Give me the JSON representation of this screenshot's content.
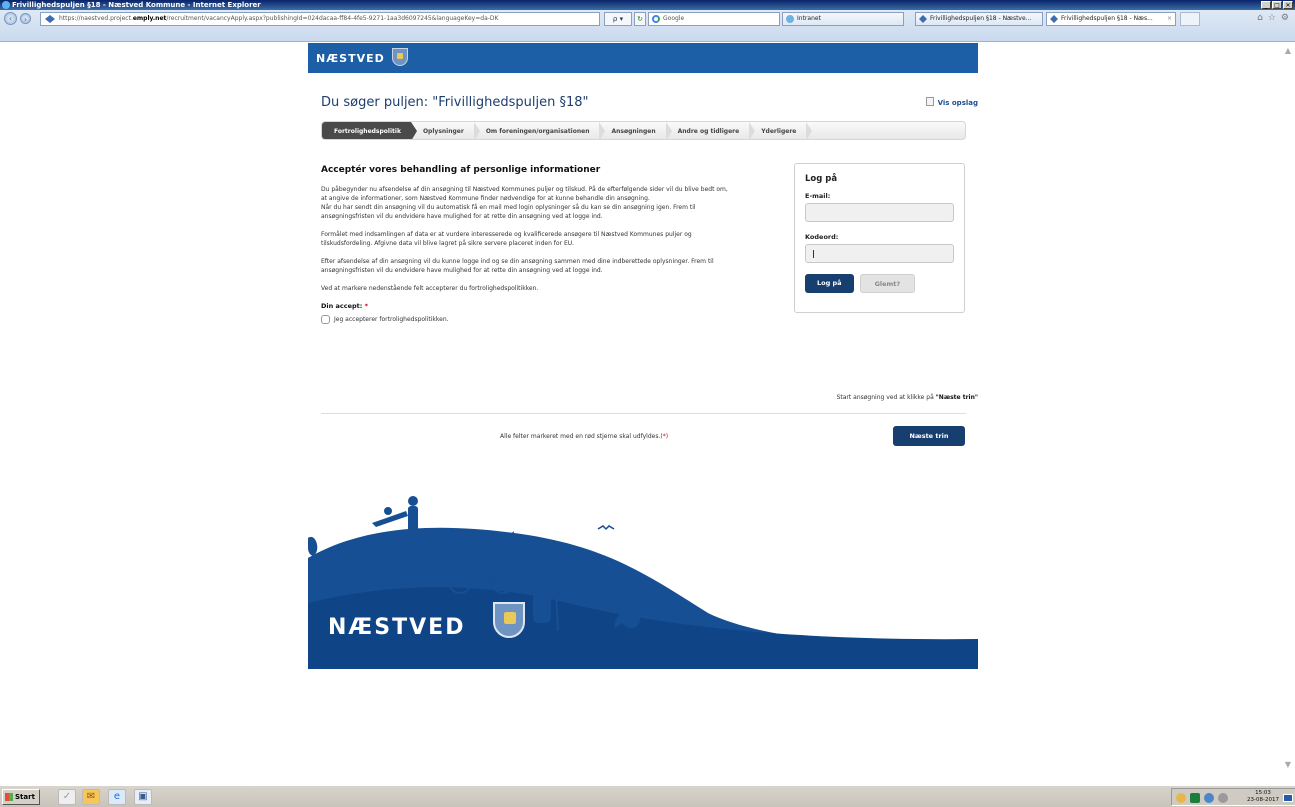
{
  "window": {
    "title": "Frivillighedspuljen §18 - Næstved Kommune - Internet Explorer",
    "controls": [
      "_",
      "□",
      "✕"
    ]
  },
  "browser": {
    "address": {
      "prefix": "https://naestved.project.",
      "domain": "emply.net",
      "suffix": "/recruitment/vacancyApply.aspx?publishingId=024dacaa-ff84-4fe5-9271-1aa3d6097245&languageKey=da-DK"
    },
    "address_controls": "ρ ▾",
    "refresh": "↻",
    "search_engine": "Google",
    "tabs": [
      {
        "label": "Intranet"
      },
      {
        "label": "Frivillighedspuljen §18 - Næstve..."
      },
      {
        "label": "Frivillighedspuljen §18 - Næs...",
        "close": "×"
      }
    ],
    "commands": [
      "⌂",
      "☆",
      "⚙"
    ]
  },
  "site": {
    "logo_text": "NÆSTVED",
    "heading": "Du søger puljen: \"Frivillighedspuljen §18\"",
    "view_posting": "Vis opslag",
    "steps": [
      {
        "label": "Fortrolighedspolitik",
        "active": true
      },
      {
        "label": "Oplysninger",
        "active": false
      },
      {
        "label": "Om foreningen/organisationen",
        "active": false
      },
      {
        "label": "Ansøgningen",
        "active": false
      },
      {
        "label": "Andre og tidligere",
        "active": false
      },
      {
        "label": "Yderligere",
        "active": false
      }
    ],
    "section_title": "Acceptér vores behandling af personlige informationer",
    "paragraphs": [
      "Du påbegynder nu afsendelse af din ansøgning til Næstved Kommunes puljer og tilskud. På de efterfølgende sider vil du blive bedt om, at angive de informationer, som Næstved Kommune finder nødvendige for at kunne behandle din ansøgning.\nNår du har sendt din ansøgning vil du automatisk få en mail med login oplysninger så du kan se din ansøgning igen. Frem til ansøgningsfristen vil du endvidere have mulighed for at rette din ansøgning ved at logge ind.",
      "Formålet med indsamlingen af data er at vurdere interesserede og kvalificerede ansøgere til Næstved Kommunes puljer og tilskudsfordeling. Afgivne data vil blive lagret på sikre servere placeret inden for EU.",
      "Efter afsendelse af din ansøgning vil du kunne logge ind og se din ansøgning sammen med dine indberettede oplysninger. Frem til ansøgningsfristen vil du endvidere have mulighed for at rette din ansøgning ved at logge ind.",
      "Ved at markere nedenstående felt accepterer du fortrolighedspolitikken."
    ],
    "accept_label": "Din accept:",
    "required_mark": "*",
    "accept_checkbox": "Jeg accepterer fortrolighedspolitikken.",
    "login": {
      "title": "Log på",
      "email_label": "E-mail:",
      "email_value": "",
      "password_label": "Kodeord:",
      "password_value": "",
      "login_button": "Log på",
      "forgot_button": "Glemt?"
    },
    "start_hint_prefix": "Start ansøgning ved at klikke på ",
    "start_hint_bold": "\"Næste trin\"",
    "required_note": "Alle felter markeret med en rød stjerne skal udfyldes.",
    "required_note_mark": "(*)",
    "next_button": "Næste trin",
    "footer_logo_text": "NÆSTVED"
  },
  "taskbar": {
    "start_label": "Start",
    "clock_time": "15:03",
    "clock_date": "23-08-2017"
  },
  "colors": {
    "brand_blue": "#1d5fa6",
    "button_navy": "#163f70",
    "required_red": "#d0021b"
  }
}
